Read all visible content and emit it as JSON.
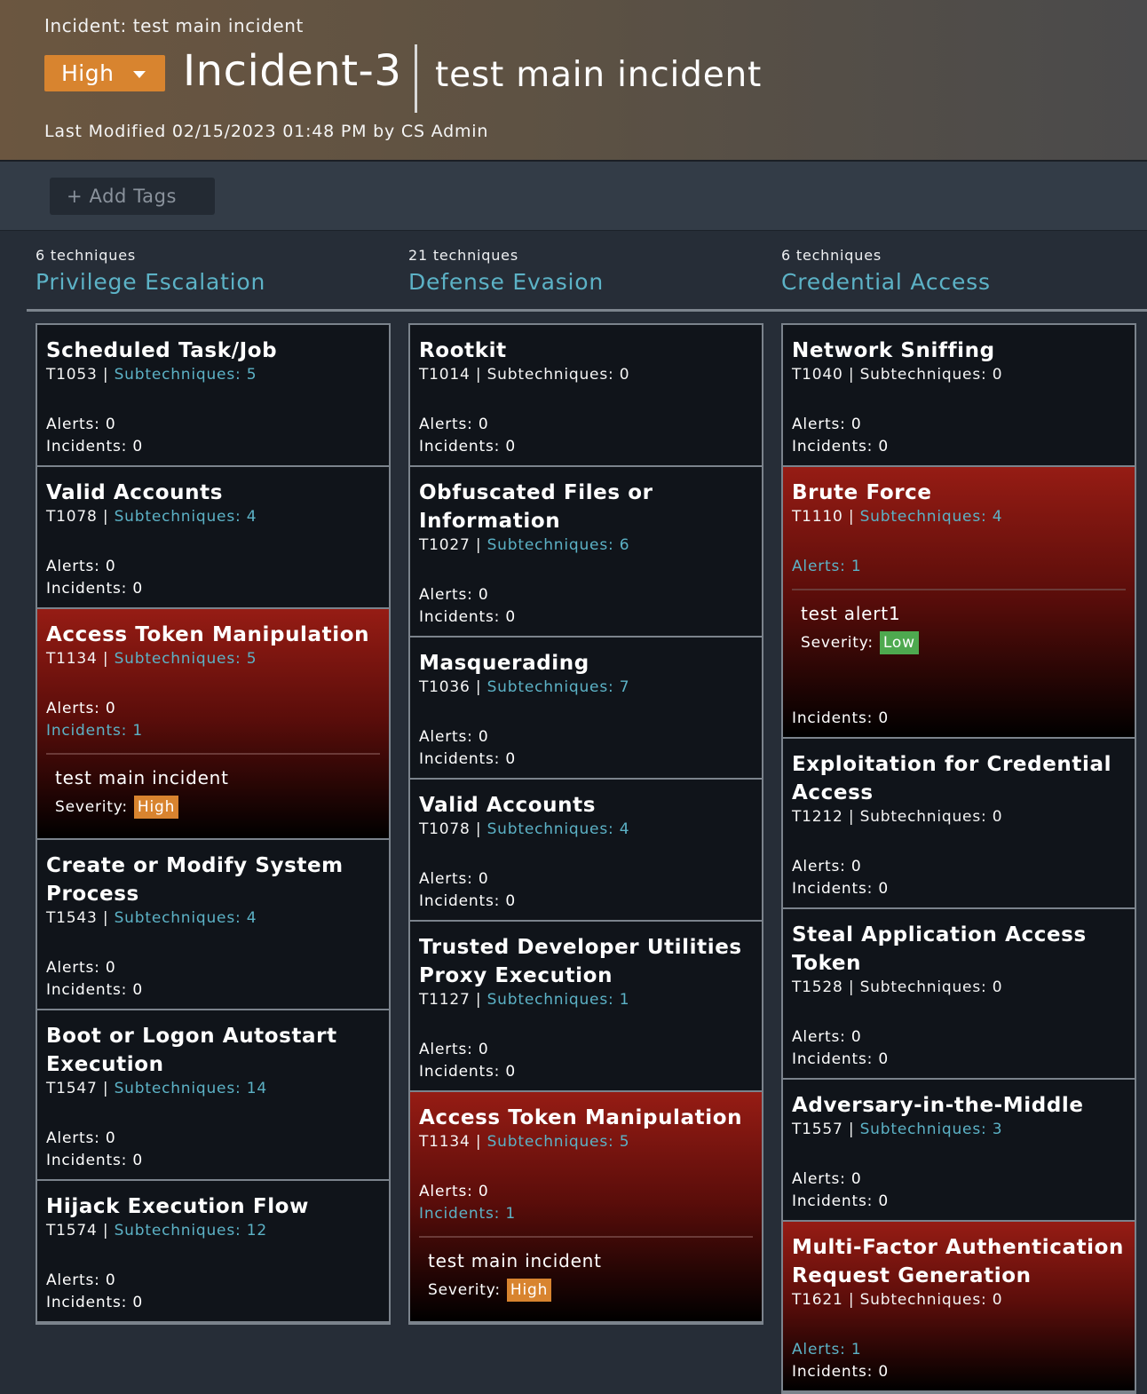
{
  "header": {
    "breadcrumb": "Incident: test main incident",
    "severity": "High",
    "incident_id": "Incident-3",
    "incident_name": "test main incident",
    "last_modified": "Last Modified 02/15/2023 01:48 PM by CS Admin"
  },
  "tags": {
    "add_label": "+ Add Tags"
  },
  "labels": {
    "alerts": "Alerts: ",
    "incidents": "Incidents: ",
    "subtechniques": "Subtechniques: ",
    "severity": "Severity:"
  },
  "columns": [
    {
      "count": "6 techniques",
      "tactic": "Privilege Escalation",
      "cards": [
        {
          "name": "Scheduled Task/Job",
          "id": "T1053",
          "sub": 5,
          "alerts": 0,
          "incidents": 0
        },
        {
          "name": "Valid Accounts",
          "id": "T1078",
          "sub": 4,
          "alerts": 0,
          "incidents": 0
        },
        {
          "name": "Access Token Manipulation",
          "id": "T1134",
          "sub": 5,
          "alerts": 0,
          "incidents": 1,
          "active": true,
          "items": [
            {
              "name": "test main incident",
              "severity": "High"
            }
          ]
        },
        {
          "name": "Create or Modify System Process",
          "id": "T1543",
          "sub": 4,
          "alerts": 0,
          "incidents": 0
        },
        {
          "name": "Boot or Logon Autostart Execution",
          "id": "T1547",
          "sub": 14,
          "alerts": 0,
          "incidents": 0
        },
        {
          "name": "Hijack Execution Flow",
          "id": "T1574",
          "sub": 12,
          "alerts": 0,
          "incidents": 0
        }
      ]
    },
    {
      "count": "21 techniques",
      "tactic": "Defense Evasion",
      "cards": [
        {
          "name": "Rootkit",
          "id": "T1014",
          "sub": 0,
          "alerts": 0,
          "incidents": 0
        },
        {
          "name": "Obfuscated Files or Information",
          "id": "T1027",
          "sub": 6,
          "alerts": 0,
          "incidents": 0
        },
        {
          "name": "Masquerading",
          "id": "T1036",
          "sub": 7,
          "alerts": 0,
          "incidents": 0
        },
        {
          "name": "Valid Accounts",
          "id": "T1078",
          "sub": 4,
          "alerts": 0,
          "incidents": 0
        },
        {
          "name": "Trusted Developer Utilities Proxy Execution",
          "id": "T1127",
          "sub": 1,
          "alerts": 0,
          "incidents": 0
        },
        {
          "name": "Access Token Manipulation",
          "id": "T1134",
          "sub": 5,
          "alerts": 0,
          "incidents": 1,
          "active": true,
          "items": [
            {
              "name": "test main incident",
              "severity": "High"
            }
          ]
        }
      ]
    },
    {
      "count": "6 techniques",
      "tactic": "Credential Access",
      "cards": [
        {
          "name": "Network Sniffing",
          "id": "T1040",
          "sub": 0,
          "alerts": 0,
          "incidents": 0
        },
        {
          "name": "Brute Force",
          "id": "T1110",
          "sub": 4,
          "alerts": 1,
          "incidents": 0,
          "active": true,
          "items": [
            {
              "name": "test alert1",
              "severity": "Low"
            }
          ]
        },
        {
          "name": "Exploitation for Credential Access",
          "id": "T1212",
          "sub": 0,
          "alerts": 0,
          "incidents": 0
        },
        {
          "name": "Steal Application Access Token",
          "id": "T1528",
          "sub": 0,
          "alerts": 0,
          "incidents": 0
        },
        {
          "name": "Adversary-in-the-Middle",
          "id": "T1557",
          "sub": 3,
          "alerts": 0,
          "incidents": 0
        },
        {
          "name": "Multi-Factor Authentication Request Generation",
          "id": "T1621",
          "sub": 0,
          "alerts": 1,
          "incidents": 0,
          "active": true
        }
      ]
    }
  ]
}
